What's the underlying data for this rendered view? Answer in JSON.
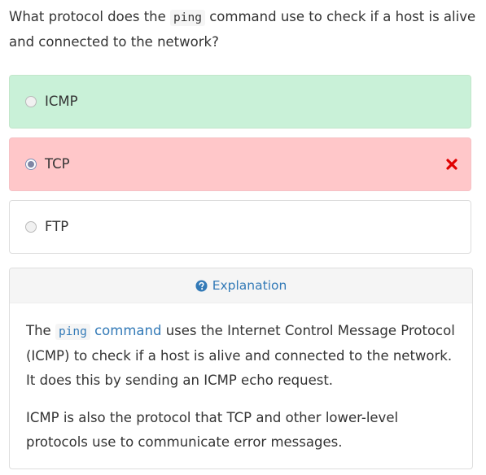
{
  "question": {
    "prefix": "What protocol does the ",
    "code": "ping",
    "suffix": " command use to check if a host is alive and connected to the network?"
  },
  "options": [
    {
      "label": "ICMP",
      "state": "correct",
      "selected": false
    },
    {
      "label": "TCP",
      "state": "wrong",
      "selected": true,
      "mark": "cross-icon"
    },
    {
      "label": "FTP",
      "state": "neutral",
      "selected": false
    }
  ],
  "explanation": {
    "header_label": "Explanation",
    "header_icon": "question-circle-icon",
    "p1": {
      "lead": "The ",
      "link_code": "ping",
      "link_text": " command",
      "rest_line1": " uses the Internet Control Message Protocol",
      "line2": "(ICMP) to check if a host is alive and connected to the network.",
      "line3": "It does this by sending an ICMP echo request."
    },
    "p2": {
      "line1": "ICMP is also the protocol that TCP and other lower-level",
      "line2": "protocols use to communicate error messages."
    }
  },
  "colors": {
    "correct_bg": "#c9f1d8",
    "wrong_bg": "#ffc7c9",
    "link": "#337ab7",
    "cross": "#e00000"
  }
}
